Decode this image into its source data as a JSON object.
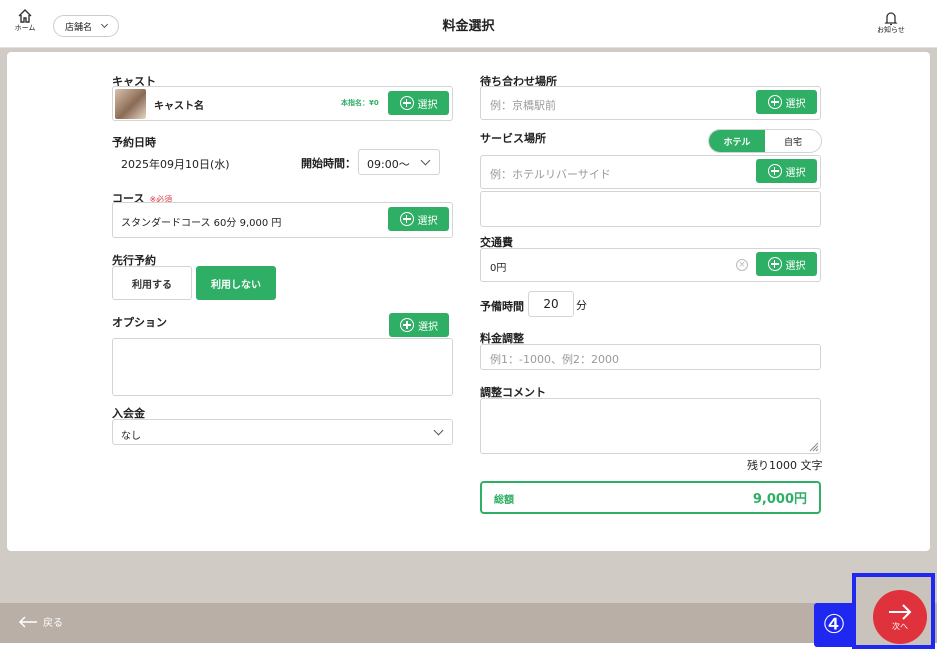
{
  "header": {
    "home_label": "ホーム",
    "store_label": "店舗名",
    "title": "料金選択",
    "notice_label": "お知らせ"
  },
  "common": {
    "select_label": "選択"
  },
  "cast": {
    "label": "キャスト",
    "name": "キャスト名",
    "designation_fee": "本指名：¥0"
  },
  "reservation": {
    "label": "予約日時",
    "date": "2025年09月10日(水)",
    "start_label": "開始時間：",
    "start_value": "09:00～"
  },
  "course": {
    "label": "コース",
    "required": "※必須",
    "value": "スタンダードコース 60分 9,000 円"
  },
  "advance": {
    "label": "先行予約",
    "use": "利用する",
    "no_use": "利用しない"
  },
  "option": {
    "label": "オプション"
  },
  "membership": {
    "label": "入会金",
    "value": "なし"
  },
  "meeting": {
    "label": "待ち合わせ場所",
    "placeholder": "例：京橋駅前"
  },
  "service": {
    "label": "サービス場所",
    "toggle_hotel": "ホテル",
    "toggle_home": "自宅",
    "placeholder": "例：ホテルリバーサイド"
  },
  "transport": {
    "label": "交通費",
    "value": "0円"
  },
  "buffer": {
    "label": "予備時間",
    "value": "20",
    "unit": "分"
  },
  "adjust": {
    "label": "料金調整",
    "placeholder": "例1：-1000、例2：2000"
  },
  "comment": {
    "label": "調整コメント",
    "remaining": "残り1000 文字"
  },
  "total": {
    "label": "総額",
    "value": "9,000円"
  },
  "footer": {
    "back": "戻る",
    "step": "④",
    "next": "次へ"
  },
  "colors": {
    "accent": "#2fae65",
    "next": "#e0323c",
    "highlight": "#1e28f0"
  }
}
